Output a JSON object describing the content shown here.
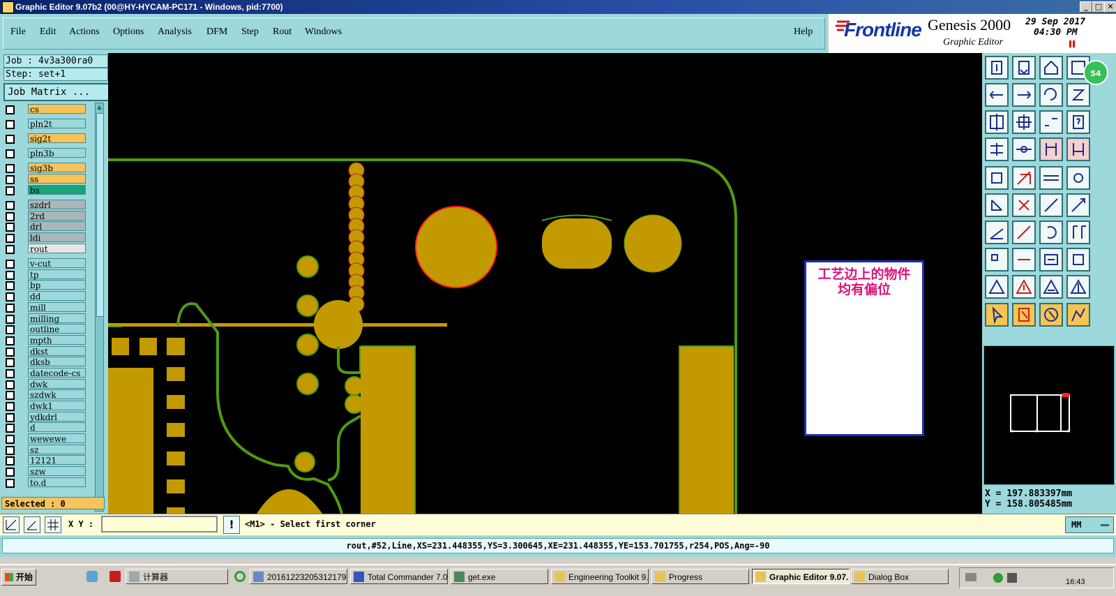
{
  "window": {
    "title": "Graphic Editor 9.07b2 (00@HY-HYCAM-PC171 - Windows, pid:7700)"
  },
  "menu": {
    "items": [
      {
        "label": "File"
      },
      {
        "label": "Edit"
      },
      {
        "label": "Actions"
      },
      {
        "label": "Options"
      },
      {
        "label": "Analysis"
      },
      {
        "label": "DFM"
      },
      {
        "label": "Step"
      },
      {
        "label": "Rout"
      },
      {
        "label": "Windows"
      }
    ],
    "help": "Help"
  },
  "brand": {
    "logo": "Frontline",
    "product": "Genesis 2000",
    "subtitle": "Graphic Editor",
    "date": "29 Sep 2017",
    "time": "04:30 PM"
  },
  "job": {
    "job_label": "Job : 4v3a300ra0",
    "step_label": "Step: set+1",
    "matrix_button": "Job Matrix ..."
  },
  "layers": [
    {
      "name": "cs",
      "color": "#f7c35a"
    },
    {
      "name": "pln2t",
      "color": "#9cd8dc"
    },
    {
      "name": "sig2t",
      "color": "#f7c35a"
    },
    {
      "name": "pln3b",
      "color": "#9cd8dc"
    },
    {
      "name": "sig3b",
      "color": "#f7c35a"
    },
    {
      "name": "ss",
      "color": "#f7c35a"
    },
    {
      "name": "bs",
      "color": "#1aa37a"
    },
    {
      "name": "szdrl",
      "color": "#a9b7bb"
    },
    {
      "name": "2rd",
      "color": "#a9b7bb"
    },
    {
      "name": "drl",
      "color": "#a9b7bb"
    },
    {
      "name": "ldi",
      "color": "#a9b7bb"
    },
    {
      "name": "rout",
      "color": "#e6e6e6"
    },
    {
      "name": "v-cut",
      "color": "#9cd8dc"
    },
    {
      "name": "tp",
      "color": "#9cd8dc"
    },
    {
      "name": "bp",
      "color": "#9cd8dc"
    },
    {
      "name": "dd",
      "color": "#9cd8dc"
    },
    {
      "name": "mill",
      "color": "#9cd8dc"
    },
    {
      "name": "milling",
      "color": "#9cd8dc"
    },
    {
      "name": "outline",
      "color": "#9cd8dc"
    },
    {
      "name": "mpth",
      "color": "#9cd8dc"
    },
    {
      "name": "dkst",
      "color": "#9cd8dc"
    },
    {
      "name": "dksb",
      "color": "#9cd8dc"
    },
    {
      "name": "datecode-cs",
      "color": "#9cd8dc"
    },
    {
      "name": "dwk",
      "color": "#9cd8dc"
    },
    {
      "name": "szdwk",
      "color": "#9cd8dc"
    },
    {
      "name": "dwk1",
      "color": "#9cd8dc"
    },
    {
      "name": "ydkdrl",
      "color": "#9cd8dc"
    },
    {
      "name": "d",
      "color": "#9cd8dc"
    },
    {
      "name": "wewewe",
      "color": "#9cd8dc"
    },
    {
      "name": "sz",
      "color": "#9cd8dc"
    },
    {
      "name": "12121",
      "color": "#9cd8dc"
    },
    {
      "name": "szw",
      "color": "#9cd8dc"
    },
    {
      "name": "to.d",
      "color": "#9cd8dc"
    }
  ],
  "selected": "Selected : 0",
  "annotation": {
    "line1": "工艺边上的物件",
    "line2": "均有偏位"
  },
  "coords": {
    "x": "X = 197.883397mm",
    "y": "Y = 158.805485mm"
  },
  "command": {
    "xy_label": "X Y :",
    "xy_value": "",
    "prompt": "<M1> - Select first corner",
    "units": "MM"
  },
  "status": "rout,#52,Line,XS=231.448355,YS=3.300645,XE=231.448355,YE=153.701755,r254,POS,Ang=-90",
  "taskbar": {
    "start": "开始",
    "items": [
      {
        "label": "计算器"
      },
      {
        "label": "20161223205312179..."
      },
      {
        "label": "Total Commander 7.0..."
      },
      {
        "label": "get.exe"
      },
      {
        "label": "Engineering Toolkit 9...."
      },
      {
        "label": "Progress"
      },
      {
        "label": "Graphic Editor 9.07...",
        "active": true
      },
      {
        "label": "Dialog Box"
      }
    ],
    "clock": "16:43"
  },
  "colors": {
    "canvas": "#000000",
    "copper": "#c29a00",
    "outline": "#4f9b10",
    "panel": "#9cd8dc",
    "highlight": "#ff2020"
  },
  "badge": "54"
}
